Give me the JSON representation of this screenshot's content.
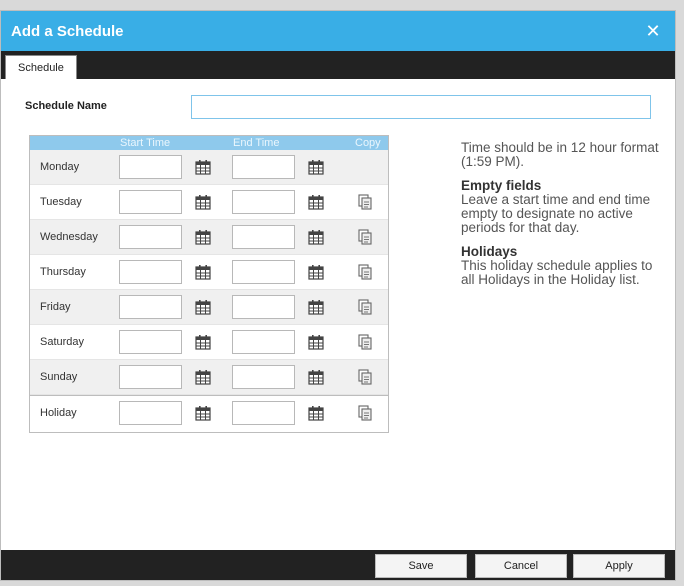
{
  "dialog": {
    "title": "Add a Schedule",
    "close_glyph": "✕",
    "tabs": [
      {
        "label": "Schedule",
        "active": true
      }
    ]
  },
  "form": {
    "schedule_name_label": "Schedule Name",
    "schedule_name_value": "",
    "schedule_name_placeholder": ""
  },
  "grid": {
    "columns": {
      "start": "Start Time",
      "end": "End Time",
      "copy": "Copy"
    },
    "rows": [
      {
        "day": "Monday",
        "start": "",
        "end": "",
        "copy": false
      },
      {
        "day": "Tuesday",
        "start": "",
        "end": "",
        "copy": true
      },
      {
        "day": "Wednesday",
        "start": "",
        "end": "",
        "copy": true
      },
      {
        "day": "Thursday",
        "start": "",
        "end": "",
        "copy": true
      },
      {
        "day": "Friday",
        "start": "",
        "end": "",
        "copy": true
      },
      {
        "day": "Saturday",
        "start": "",
        "end": "",
        "copy": true
      },
      {
        "day": "Sunday",
        "start": "",
        "end": "",
        "copy": true
      },
      {
        "day": "Holiday",
        "start": "",
        "end": "",
        "copy": true
      }
    ]
  },
  "help": {
    "intro": "Time should be in 12 hour format (1:59 PM).",
    "empty_heading": "Empty fields",
    "empty_text": "Leave a start time and end time empty to designate no active periods for that day.",
    "holidays_heading": "Holidays",
    "holidays_text": "This holiday schedule applies to all Holidays in the Holiday list."
  },
  "footer": {
    "save": "Save",
    "cancel": "Cancel",
    "apply": "Apply"
  },
  "colors": {
    "titlebar": "#39aee6",
    "header": "#8ec9ec",
    "footer": "#222222"
  },
  "icons": {
    "picker": "calendar-icon",
    "copy": "copy-icon",
    "close": "close-icon"
  }
}
